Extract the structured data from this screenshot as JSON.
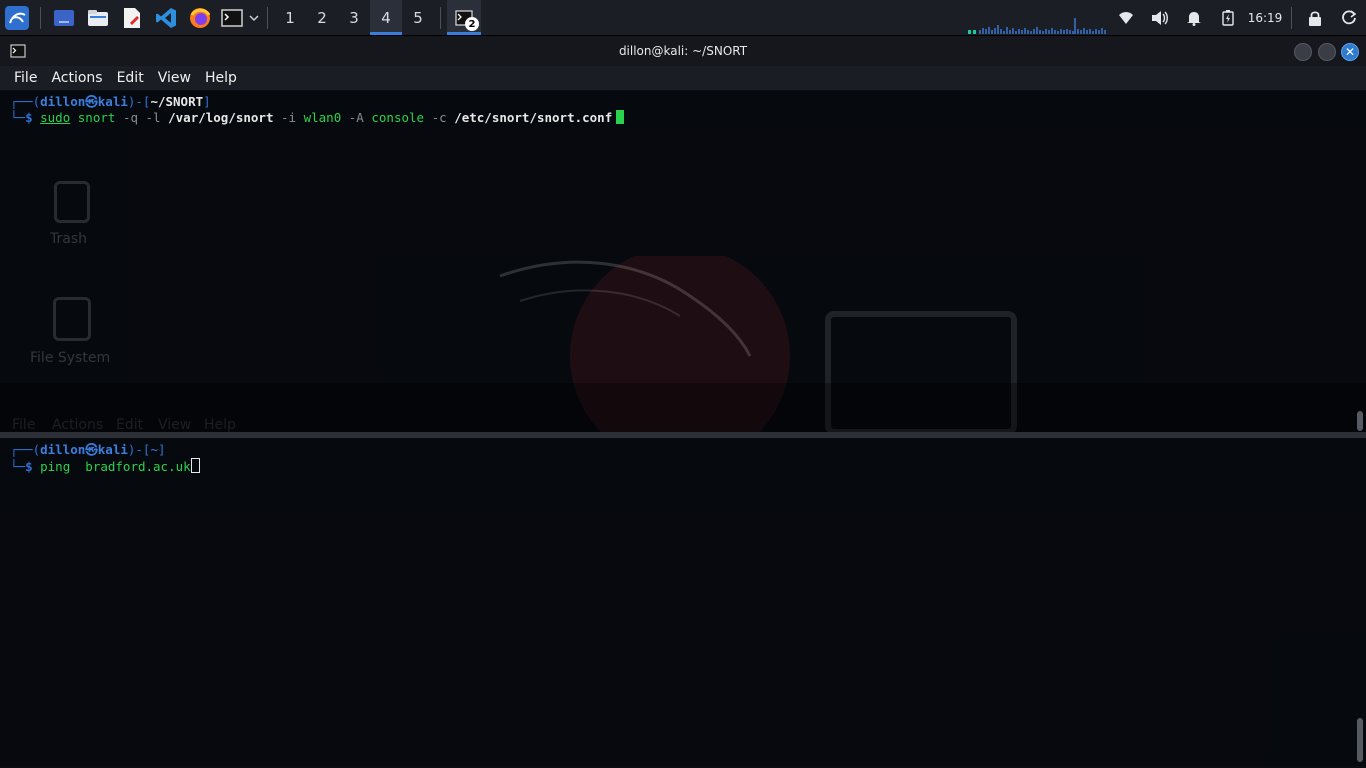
{
  "panel": {
    "workspaces": [
      "1",
      "2",
      "3",
      "4",
      "5"
    ],
    "active_workspace": "4",
    "task_badge": "2",
    "clock": "16:19"
  },
  "window": {
    "title": "dillon@kali: ~/SNORT",
    "menu": [
      "File",
      "Actions",
      "Edit",
      "View",
      "Help"
    ]
  },
  "pane_top": {
    "prompt_user": "dillon㉿kali",
    "prompt_dir": "~/SNORT",
    "cmd_sudo": "sudo",
    "cmd_snort": "snort",
    "opt_q": "-q",
    "opt_l": "-l",
    "log_path": "/var/log/snort",
    "opt_i": "-i",
    "iface": "wlan0",
    "opt_A": "-A",
    "mode": "console",
    "opt_c": "-c",
    "conf_path": "/etc/snort/snort.conf"
  },
  "pane_bottom": {
    "prompt_user": "dillon㉿kali",
    "prompt_dir": "~",
    "cmd": "ping",
    "host": "bradford.ac.uk"
  },
  "desktop_ghost": {
    "trash_label": "Trash",
    "fs_label": "File System",
    "menu_ghost": [
      "File",
      "Actions",
      "Edit",
      "View",
      "Help"
    ]
  },
  "colors": {
    "accent": "#3b7ddd",
    "prompt": "#2f72d6",
    "command": "#2bd24d"
  }
}
